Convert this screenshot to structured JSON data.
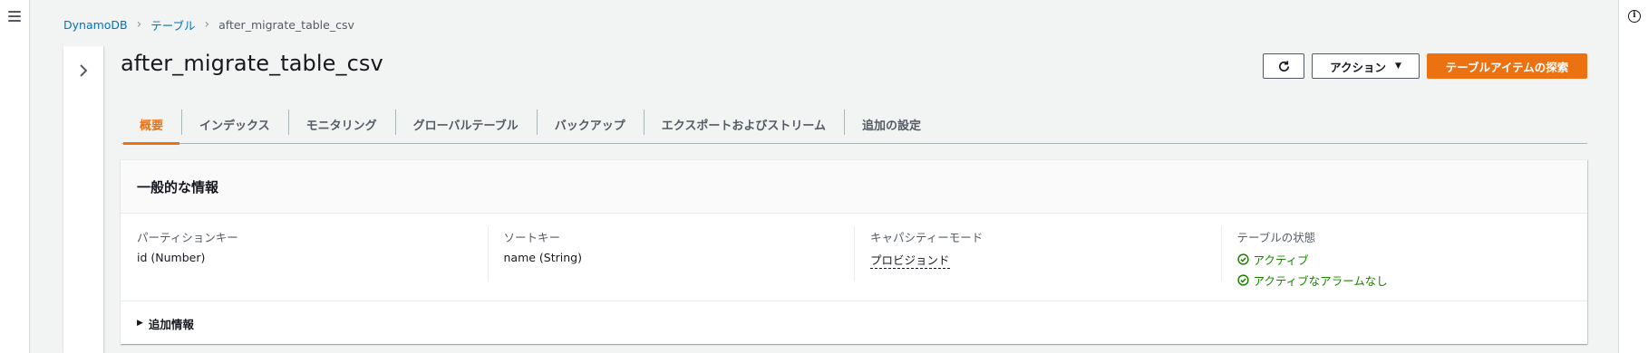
{
  "breadcrumb": {
    "items": [
      "DynamoDB",
      "テーブル"
    ],
    "current": "after_migrate_table_csv"
  },
  "page": {
    "title": "after_migrate_table_csv"
  },
  "header_actions": {
    "actions_label": "アクション",
    "primary_label": "テーブルアイテムの探索"
  },
  "tabs": [
    {
      "label": "概要",
      "active": true
    },
    {
      "label": "インデックス"
    },
    {
      "label": "モニタリング"
    },
    {
      "label": "グローバルテーブル"
    },
    {
      "label": "バックアップ"
    },
    {
      "label": "エクスポートおよびストリーム"
    },
    {
      "label": "追加の設定"
    }
  ],
  "general_info": {
    "title": "一般的な情報",
    "partition_key": {
      "label": "パーティションキー",
      "value": "id (Number)"
    },
    "sort_key": {
      "label": "ソートキー",
      "value": "name (String)"
    },
    "capacity_mode": {
      "label": "キャパシティーモード",
      "value": "プロビジョンド"
    },
    "table_status": {
      "label": "テーブルの状態",
      "statuses": [
        "アクティブ",
        "アクティブなアラームなし"
      ]
    },
    "additional_info_label": "追加情報"
  },
  "colors": {
    "accent": "#ec7211",
    "link": "#0073bb",
    "success": "#1d8102"
  }
}
